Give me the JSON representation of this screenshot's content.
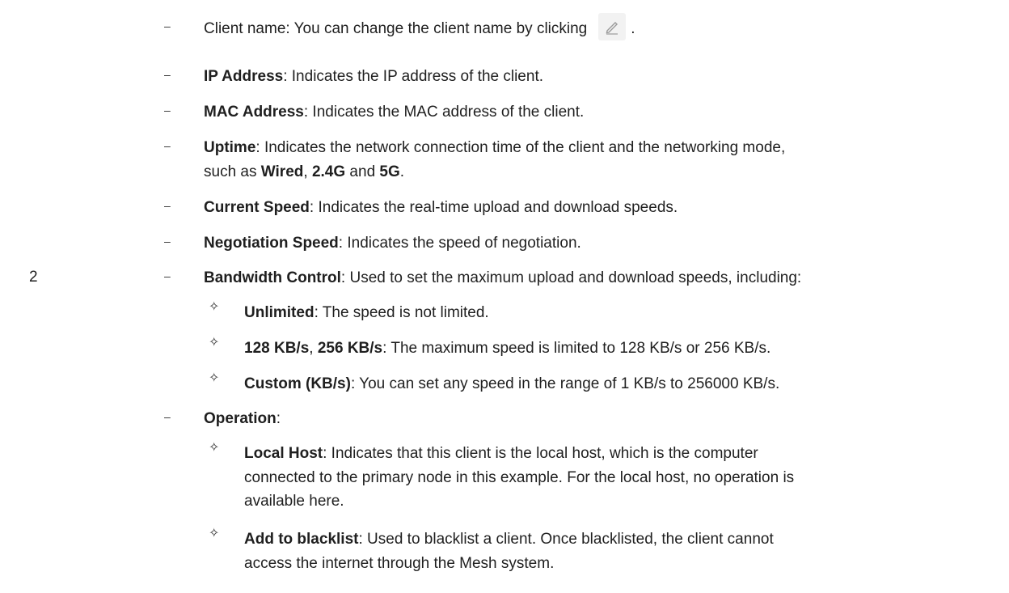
{
  "step_number": "2",
  "items": {
    "client_name": {
      "text": "Client name: You can change the client name by clicking",
      "suffix": "."
    },
    "ip": {
      "term": "IP Address",
      "desc": ": Indicates the IP address of the client."
    },
    "mac": {
      "term": "MAC Address",
      "desc": ": Indicates the MAC address of the client."
    },
    "uptime": {
      "term": "Uptime",
      "desc": ": Indicates the network connection time of the client and the networking mode,",
      "line2_prefix": "such as ",
      "mode1": "Wired",
      "sep1": ", ",
      "mode2": "2.4G",
      "sep2": " and ",
      "mode3": "5G",
      "end": "."
    },
    "current_speed": {
      "term": "Current Speed",
      "desc": ": Indicates the real-time upload and download speeds."
    },
    "negotiation_speed": {
      "term": "Negotiation Speed",
      "desc": ": Indicates the speed of negotiation."
    },
    "bandwidth": {
      "term": "Bandwidth Control",
      "desc": ": Used to set the maximum upload and download speeds, including:",
      "subs": {
        "unlimited": {
          "term": "Unlimited",
          "desc": ": The speed is not limited."
        },
        "fixed": {
          "term1": "128 KB/s",
          "sep": ", ",
          "term2": "256 KB/s",
          "desc": ": The maximum speed is limited to 128 KB/s or 256 KB/s."
        },
        "custom": {
          "term": "Custom (KB/s)",
          "desc": ": You can set any speed in the range of 1 KB/s to 256000 KB/s."
        }
      }
    },
    "operation": {
      "term": "Operation",
      "desc": ":",
      "subs": {
        "local_host": {
          "term": "Local Host",
          "desc": ": Indicates that this client is the local host, which is the computer",
          "line2": "connected to the primary node in this example. For the local host, no operation is",
          "line3": "available here."
        },
        "blacklist": {
          "term": "Add to blacklist",
          "desc": ": Used to blacklist a client. Once blacklisted, the client cannot",
          "line2": "access the internet through the Mesh system."
        }
      }
    }
  },
  "markers": {
    "dash": "–",
    "diamond": "✧"
  },
  "icons": {
    "edit": "pencil-edit-icon"
  }
}
